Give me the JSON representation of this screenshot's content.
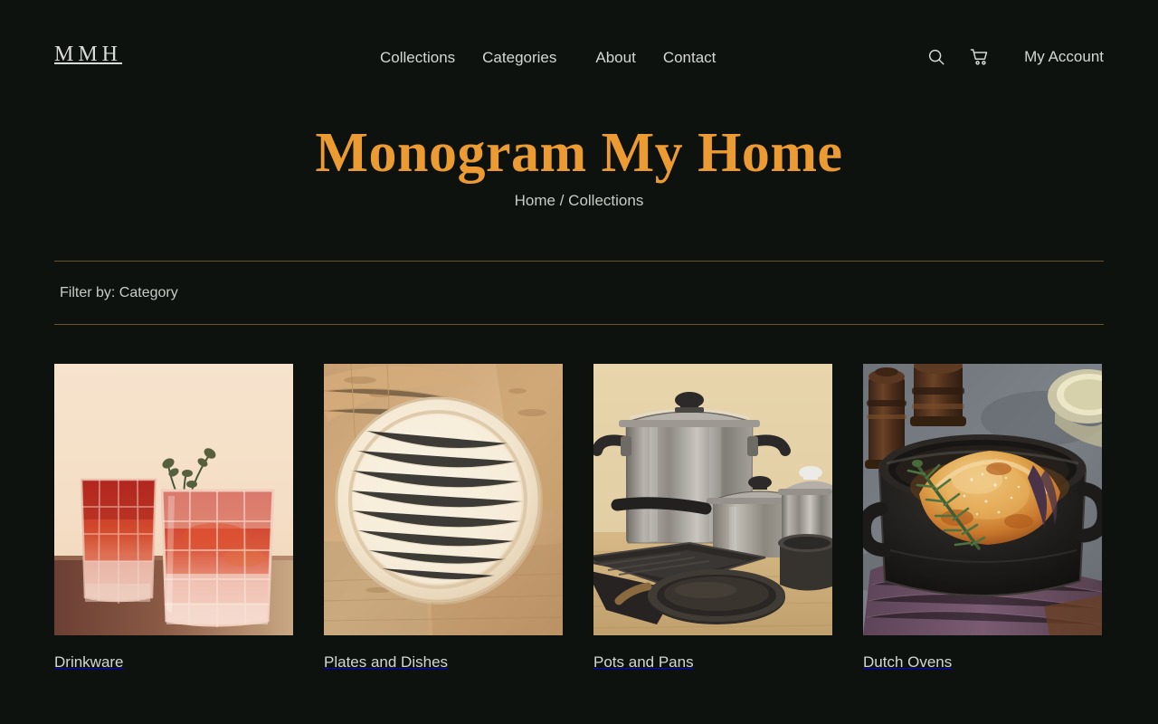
{
  "site": {
    "logo": "MMH",
    "background_color": "#0d120f",
    "accent_color": "#eb9b32",
    "rule_color": "#6d5227"
  },
  "header": {
    "nav": [
      {
        "label": "Collections"
      },
      {
        "label": "Categories"
      },
      {
        "label": "About"
      },
      {
        "label": "Contact"
      }
    ],
    "search_icon": "search-icon",
    "cart_icon": "shopping-cart-icon",
    "account_label": "My Account"
  },
  "hero": {
    "title": "Monogram My Home",
    "breadcrumb": "Home / Collections"
  },
  "filter": {
    "label": "Filter by: Category"
  },
  "collections": [
    {
      "label": "Drinkware",
      "image_alt": "Two cut-crystal rocks glasses filled with a red cocktail and ice, garnished with thyme sprigs, on a wooden table against a cream backdrop"
    },
    {
      "label": "Plates and Dishes",
      "image_alt": "A round pale palm-leaf plate resting on stacked wooden boards and a rustic wood surface"
    },
    {
      "label": "Pots and Pans",
      "image_alt": "A set of stainless steel stockpots with lids and black non-stick grill pans and skillets on a wooden counter against a beige wall"
    },
    {
      "label": "Dutch Ovens",
      "image_alt": "A black cast-iron Dutch oven holding a roasted chicken with rosemary, beside wooden pepper mills and a purple cloth on slate"
    }
  ]
}
